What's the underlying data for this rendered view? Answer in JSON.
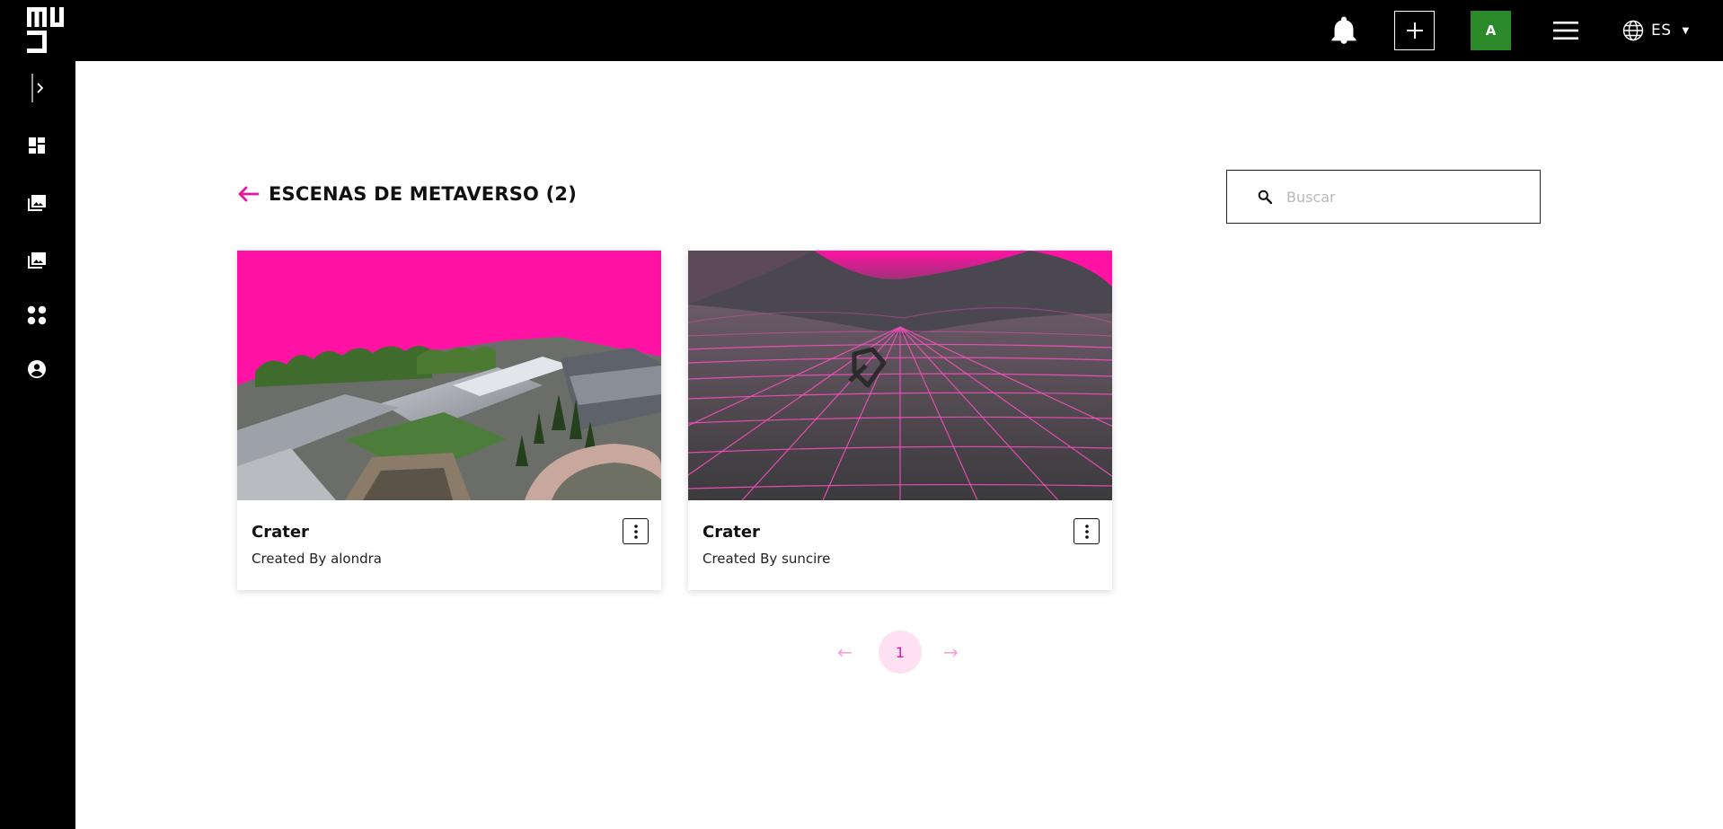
{
  "header": {
    "logo_text": "MUY",
    "lang_label": "ES",
    "avatar_letter": "A",
    "avatar_color": "#2a8a2a"
  },
  "sidebar": {
    "items": [
      {
        "icon": "chevron-right-icon"
      },
      {
        "icon": "dashboard-icon"
      },
      {
        "icon": "photo-library-icon"
      },
      {
        "icon": "image-icon"
      },
      {
        "icon": "apps-icon"
      },
      {
        "icon": "account-icon"
      }
    ]
  },
  "main": {
    "title": "ESCENAS DE METAVERSO (2)",
    "accent_color": "#e6179e",
    "search": {
      "placeholder": "Buscar",
      "value": ""
    },
    "cards": [
      {
        "name": "Crater",
        "created_by": "Created By alondra",
        "thumb": "aerial-city-scene"
      },
      {
        "name": "Crater",
        "created_by": "Created By suncire",
        "thumb": "neon-grid-scene"
      }
    ],
    "pagination": {
      "current": "1",
      "prev_label": "←",
      "next_label": "→"
    }
  }
}
